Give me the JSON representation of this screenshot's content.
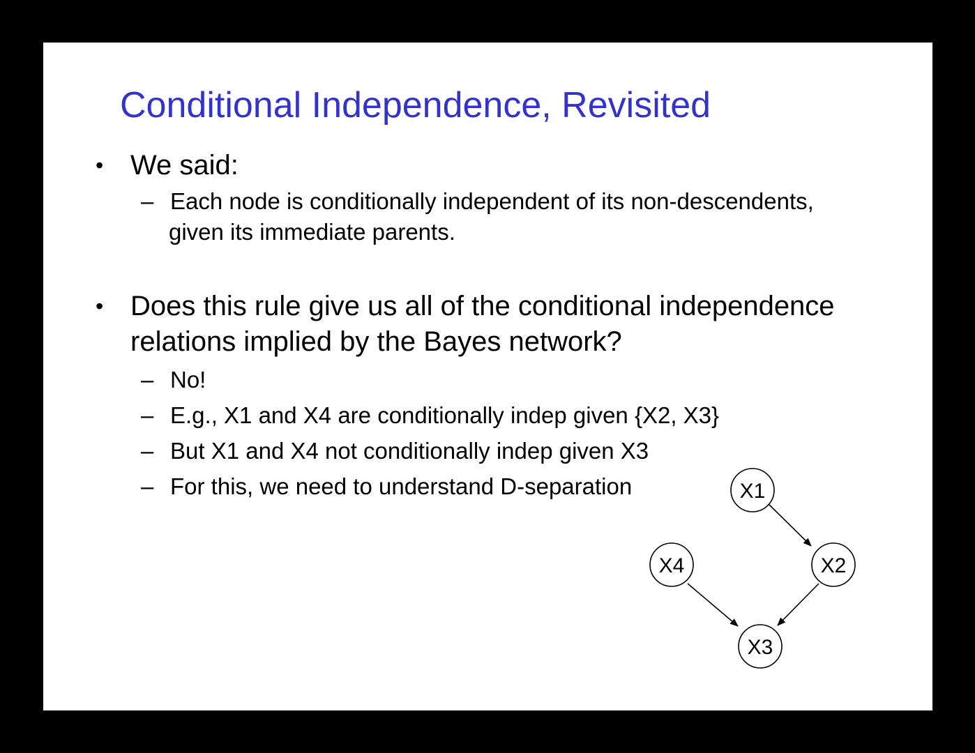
{
  "slide": {
    "title": "Conditional Independence, Revisited",
    "bullets": [
      {
        "text": "We said:",
        "subitems": [
          {
            "line1": "Each node is conditionally independent of its non-descendents,",
            "line2": "given its immediate parents."
          }
        ]
      },
      {
        "line1": "Does this rule give us all of the conditional independence",
        "line2": "relations implied by the Bayes network?",
        "subitems": [
          {
            "text": "No!"
          },
          {
            "text": "E.g., X1 and X4 are conditionally indep given {X2, X3}"
          },
          {
            "text": "But X1 and X4 not conditionally indep given X3"
          },
          {
            "text": "For this, we need to understand D-separation"
          }
        ]
      }
    ],
    "bullet_mark": "•",
    "sub_mark": "–"
  },
  "graph": {
    "nodes": [
      {
        "id": "X1",
        "label": "X1"
      },
      {
        "id": "X2",
        "label": "X2"
      },
      {
        "id": "X3",
        "label": "X3"
      },
      {
        "id": "X4",
        "label": "X4"
      }
    ],
    "edges": [
      {
        "from": "X1",
        "to": "X2"
      },
      {
        "from": "X2",
        "to": "X3"
      },
      {
        "from": "X4",
        "to": "X3"
      }
    ]
  },
  "colors": {
    "title": "#3333cc",
    "text": "#000000",
    "background": "#ffffff",
    "frame": "#000000"
  }
}
